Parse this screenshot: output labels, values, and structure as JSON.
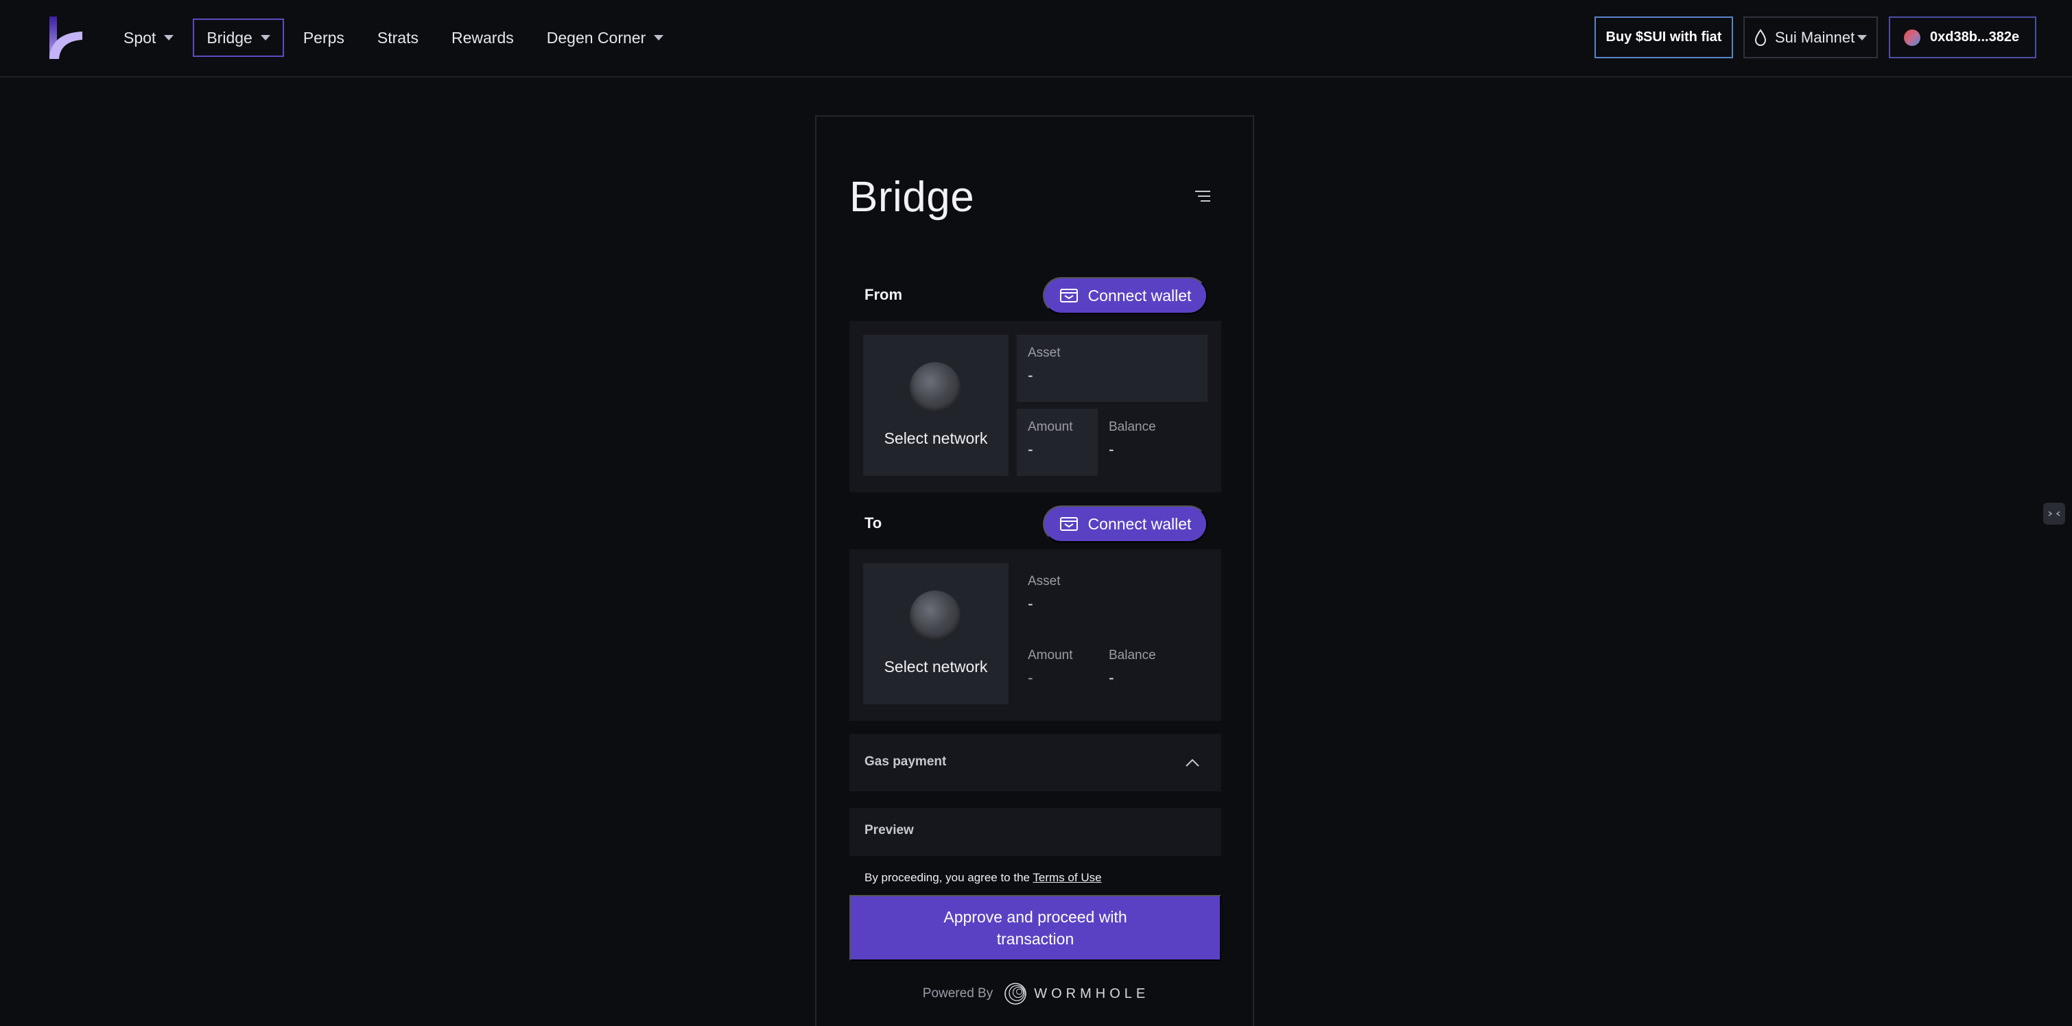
{
  "nav": {
    "items": [
      {
        "label": "Spot",
        "has_dropdown": true,
        "active": false
      },
      {
        "label": "Bridge",
        "has_dropdown": true,
        "active": true
      },
      {
        "label": "Perps",
        "has_dropdown": false,
        "active": false
      },
      {
        "label": "Strats",
        "has_dropdown": false,
        "active": false
      },
      {
        "label": "Rewards",
        "has_dropdown": false,
        "active": false
      },
      {
        "label": "Degen Corner",
        "has_dropdown": true,
        "active": false
      }
    ]
  },
  "header": {
    "buy_label": "Buy $SUI with fiat",
    "network_label": "Sui Mainnet",
    "wallet_address": "0xd38b...382e"
  },
  "bridge": {
    "title": "Bridge",
    "from": {
      "label": "From",
      "connect_label": "Connect wallet",
      "network_label": "Select network",
      "asset_label": "Asset",
      "asset_value": "-",
      "amount_label": "Amount",
      "amount_value": "-",
      "balance_label": "Balance",
      "balance_value": "-"
    },
    "to": {
      "label": "To",
      "connect_label": "Connect wallet",
      "network_label": "Select network",
      "asset_label": "Asset",
      "asset_value": "-",
      "amount_label": "Amount",
      "amount_value": "-",
      "balance_label": "Balance",
      "balance_value": "-"
    },
    "gas_label": "Gas payment",
    "preview_label": "Preview",
    "terms_prefix": "By proceeding, you agree to the",
    "terms_link": "Terms of Use",
    "approve_label": "Approve and proceed with transaction",
    "powered_by": "Powered By",
    "provider": "WORMHOLE"
  },
  "colors": {
    "background": "#0c0d11",
    "accent": "#5a41c4",
    "card": "#16171c",
    "field": "#22242b"
  }
}
